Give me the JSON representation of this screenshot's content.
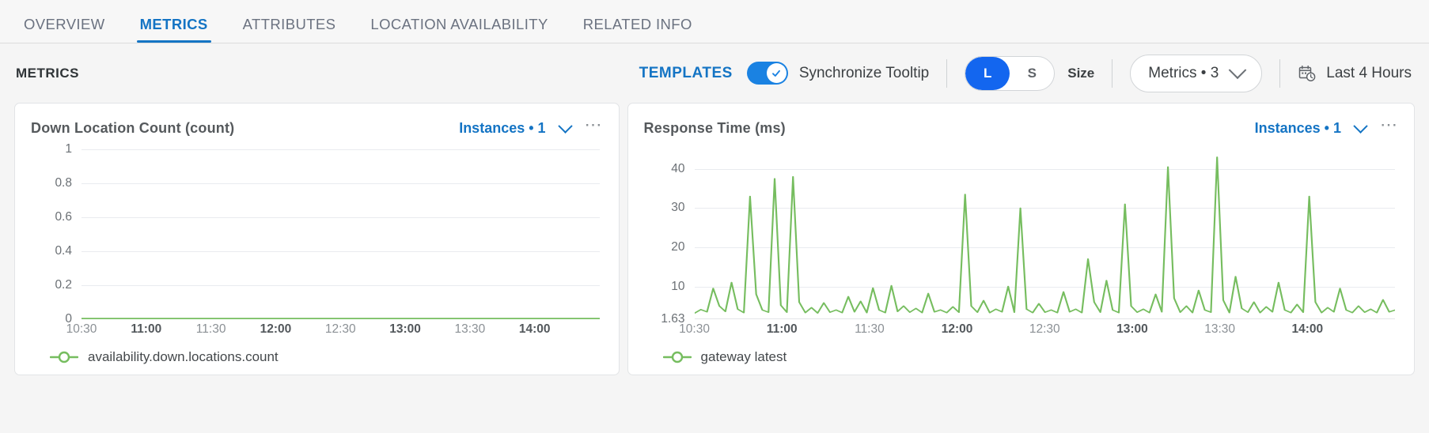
{
  "tabs": [
    {
      "label": "OVERVIEW",
      "active": false
    },
    {
      "label": "METRICS",
      "active": true
    },
    {
      "label": "ATTRIBUTES",
      "active": false
    },
    {
      "label": "LOCATION AVAILABILITY",
      "active": false
    },
    {
      "label": "RELATED INFO",
      "active": false
    }
  ],
  "toolbar": {
    "title": "METRICS",
    "templates_label": "TEMPLATES",
    "sync_tooltip_label": "Synchronize Tooltip",
    "sync_tooltip_on": true,
    "size_options": [
      {
        "label": "L",
        "selected": true
      },
      {
        "label": "S",
        "selected": false
      }
    ],
    "size_caption": "Size",
    "metrics_dropdown": "Metrics • 3",
    "time_range": "Last 4 Hours",
    "accent_blue": "#1474c4",
    "selected_blue": "#1366ef"
  },
  "charts": [
    {
      "title": "Down Location Count (count)",
      "instances_label": "Instances • 1",
      "menu_label": "⋯",
      "legend": "availability.down.locations.count",
      "series_color": "#76bd5f"
    },
    {
      "title": "Response Time (ms)",
      "instances_label": "Instances • 1",
      "menu_label": "⋯",
      "legend": "gateway latest",
      "series_color": "#76bd5f"
    }
  ],
  "chart_data": [
    {
      "type": "line",
      "title": "Down Location Count (count)",
      "xlabel": "",
      "ylabel": "count",
      "legend_position": "bottom-left",
      "grid": true,
      "series": [
        {
          "name": "availability.down.locations.count",
          "color": "#76bd5f",
          "values": [
            0,
            0,
            0,
            0,
            0,
            0,
            0,
            0,
            0,
            0,
            0,
            0,
            0,
            0,
            0,
            0,
            0,
            0,
            0,
            0,
            0,
            0,
            0,
            0,
            0,
            0,
            0,
            0,
            0,
            0,
            0,
            0,
            0,
            0,
            0,
            0,
            0,
            0,
            0,
            0,
            0,
            0,
            0,
            0,
            0,
            0,
            0,
            0,
            0,
            0,
            0,
            0,
            0,
            0,
            0,
            0,
            0,
            0,
            0,
            0,
            0,
            0,
            0,
            0,
            0,
            0,
            0,
            0,
            0,
            0,
            0,
            0,
            0,
            0,
            0,
            0,
            0,
            0,
            0,
            0
          ]
        }
      ],
      "ytick_labels": [
        "1",
        "0.8",
        "0.6",
        "0.4",
        "0.2",
        "0"
      ],
      "ytick_values": [
        1,
        0.8,
        0.6,
        0.4,
        0.2,
        0
      ],
      "ylim": [
        0,
        1
      ],
      "xtick_labels": [
        "10:30",
        "11:00",
        "11:30",
        "12:00",
        "12:30",
        "13:00",
        "13:30",
        "14:00"
      ],
      "xtick_major": [
        false,
        true,
        false,
        true,
        false,
        true,
        false,
        true
      ],
      "xlim": [
        "10:30",
        "14:30"
      ]
    },
    {
      "type": "line",
      "title": "Response Time (ms)",
      "xlabel": "",
      "ylabel": "ms",
      "legend_position": "bottom-left",
      "grid": true,
      "series": [
        {
          "name": "gateway latest",
          "color": "#76bd5f",
          "values": [
            3.2,
            4.1,
            3.5,
            9.5,
            5.0,
            3.6,
            11.0,
            4.2,
            3.3,
            33.0,
            8.0,
            4.0,
            3.4,
            37.5,
            5.2,
            3.4,
            38.0,
            6.0,
            3.3,
            4.6,
            3.2,
            5.8,
            3.4,
            4.0,
            3.3,
            7.4,
            3.5,
            6.2,
            3.3,
            9.6,
            4.0,
            3.3,
            10.2,
            3.6,
            5.0,
            3.4,
            4.4,
            3.3,
            8.2,
            3.5,
            4.0,
            3.3,
            4.8,
            3.4,
            33.5,
            5.0,
            3.4,
            6.4,
            3.3,
            4.2,
            3.5,
            10.0,
            3.4,
            30.0,
            4.2,
            3.3,
            5.6,
            3.4,
            4.0,
            3.3,
            8.6,
            3.5,
            4.2,
            3.3,
            17.0,
            6.0,
            3.4,
            11.5,
            4.0,
            3.3,
            31.0,
            5.0,
            3.4,
            4.2,
            3.3,
            8.0,
            3.5,
            40.5,
            7.0,
            3.4,
            5.0,
            3.3,
            9.0,
            4.0,
            3.4,
            43.0,
            6.5,
            3.3,
            12.5,
            4.4,
            3.4,
            6.0,
            3.3,
            4.8,
            3.5,
            11.0,
            4.0,
            3.3,
            5.4,
            3.4,
            33.0,
            6.0,
            3.3,
            4.6,
            3.5,
            9.5,
            4.0,
            3.3,
            5.0,
            3.4,
            4.2,
            3.3,
            6.6,
            3.5,
            4.0
          ]
        }
      ],
      "ytick_labels": [
        "40",
        "30",
        "20",
        "10",
        "1.63"
      ],
      "ytick_values": [
        40,
        30,
        20,
        10,
        1.63
      ],
      "ylim": [
        1.63,
        45
      ],
      "xtick_labels": [
        "10:30",
        "11:00",
        "11:30",
        "12:00",
        "12:30",
        "13:00",
        "13:30",
        "14:00"
      ],
      "xtick_major": [
        false,
        true,
        false,
        true,
        false,
        true,
        false,
        true
      ],
      "xlim": [
        "10:30",
        "14:30"
      ]
    }
  ]
}
